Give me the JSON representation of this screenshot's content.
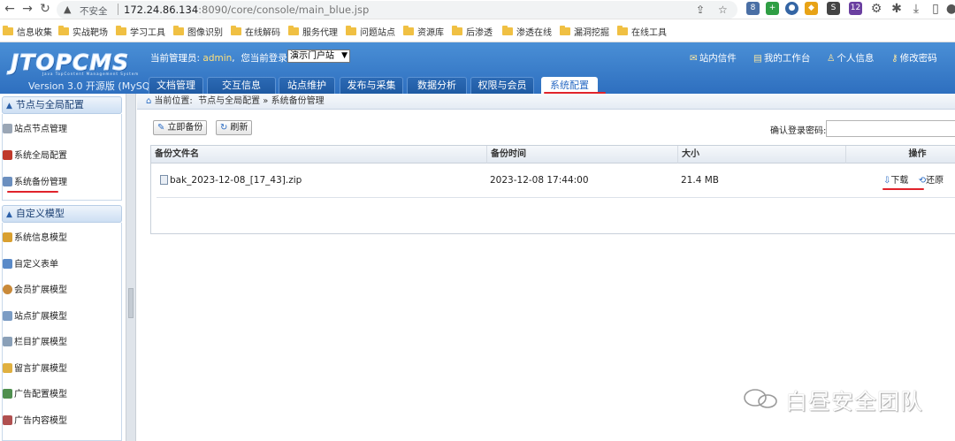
{
  "browser": {
    "insecure_label": "不安全",
    "url_host": "172.24.86.134",
    "url_rest": ":8090/core/console/main_blue.jsp",
    "ext_badges": [
      "8",
      "12"
    ]
  },
  "bookmarks": [
    "信息收集",
    "实战靶场",
    "学习工具",
    "图像识别",
    "在线解码",
    "服务代理",
    "问题站点",
    "资源库",
    "后渗透",
    "渗透在线",
    "漏洞挖掘",
    "在线工具"
  ],
  "header": {
    "logo": "JTOPCMS",
    "logo_sub": "Java TopContent Management System",
    "version": "Version 3.0  开源版 (MySQL)",
    "admin_prefix": "当前管理员:",
    "admin_name": "admin",
    "site_prefix": "您当前登录在",
    "site_select": "演示门户站",
    "top_links": [
      "站内信件",
      "我的工作台",
      "个人信息",
      "修改密码"
    ],
    "tabs": [
      "文档管理",
      "交互信息",
      "站点维护",
      "发布与采集",
      "数据分析",
      "权限与会员",
      "系统配置"
    ]
  },
  "sidebar": {
    "group1": "节点与全局配置",
    "group1_items": [
      "站点节点管理",
      "系统全局配置",
      "系统备份管理"
    ],
    "group2": "自定义模型",
    "group2_items": [
      "系统信息模型",
      "自定义表单",
      "会员扩展模型",
      "站点扩展模型",
      "栏目扩展模型",
      "留言扩展模型",
      "广告配置模型",
      "广告内容模型"
    ]
  },
  "main": {
    "crumb_prefix": "当前位置:",
    "crumb_path": "节点与全局配置 » 系统备份管理",
    "backup_button": "立即备份",
    "refresh_button": "刷新",
    "password_label": "确认登录密码:",
    "columns": [
      "备份文件名",
      "备份时间",
      "大小",
      "操作"
    ],
    "rows": [
      {
        "file": "bak_2023-12-08_[17_43].zip",
        "time": "2023-12-08 17:44:00",
        "size": "21.4 MB",
        "download": "下载",
        "restore": "还原"
      }
    ]
  },
  "watermark": "白昼安全团队",
  "colors": {
    "accent": "#2e6fbf",
    "underline": "#e0232b"
  }
}
